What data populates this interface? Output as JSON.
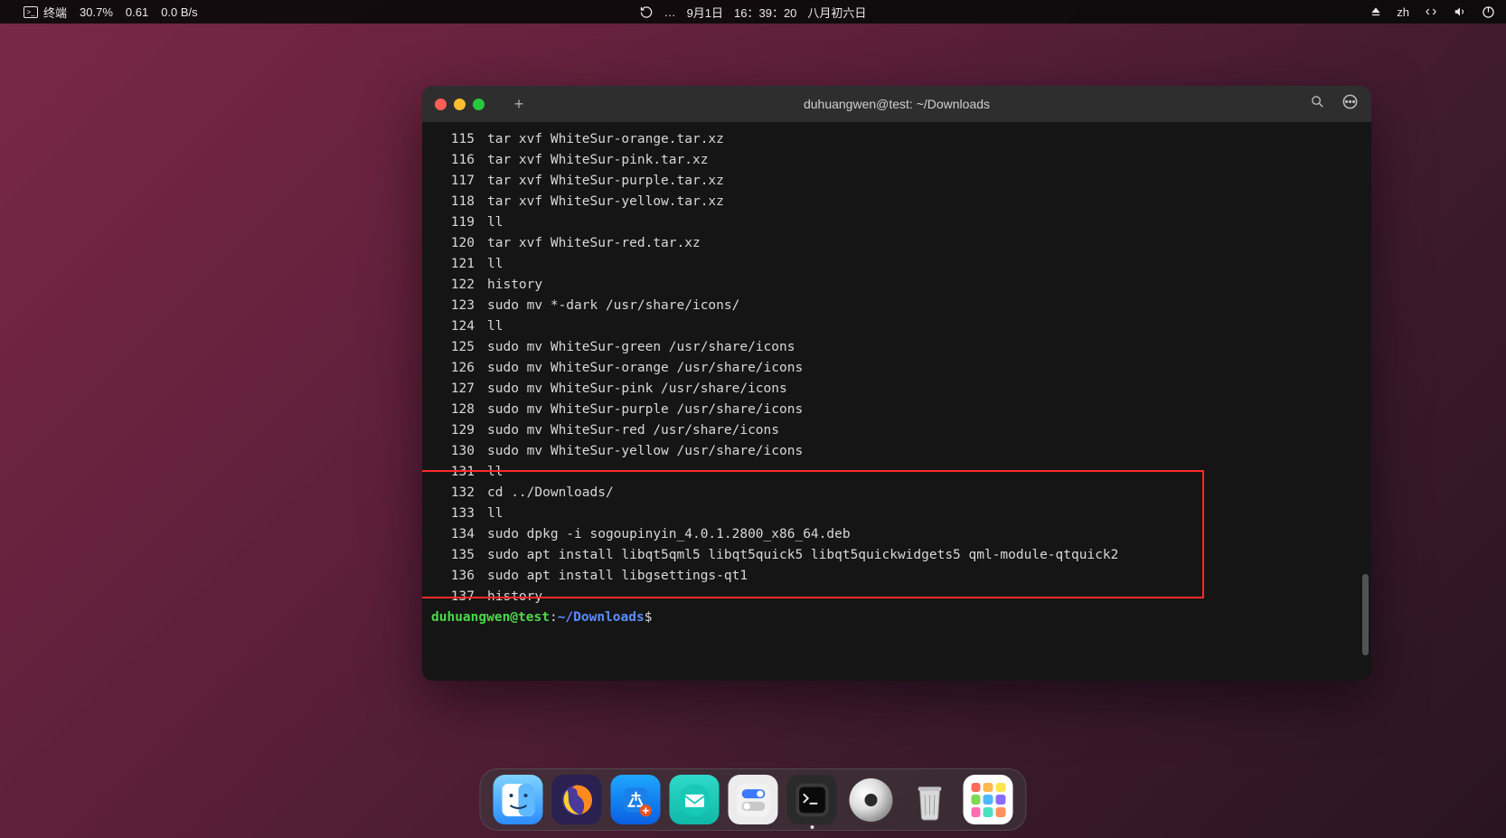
{
  "menubar": {
    "app_name": "终端",
    "stat1": "30.7%",
    "stat2": "0.61",
    "stat3": "0.0 B/s",
    "center_date": "9月1日",
    "center_time": "16：39：20",
    "center_lunar": "八月初六日",
    "center_ellipsis": "…",
    "input_lang": "zh"
  },
  "terminal": {
    "title": "duhuangwen@test: ~/Downloads",
    "prompt_user": "duhuangwen@test",
    "prompt_colon": ":",
    "prompt_path": "~/Downloads",
    "prompt_dollar": "$",
    "history": [
      {
        "n": "115",
        "cmd": "tar xvf WhiteSur-orange.tar.xz"
      },
      {
        "n": "116",
        "cmd": "tar xvf WhiteSur-pink.tar.xz"
      },
      {
        "n": "117",
        "cmd": "tar xvf WhiteSur-purple.tar.xz"
      },
      {
        "n": "118",
        "cmd": "tar xvf WhiteSur-yellow.tar.xz"
      },
      {
        "n": "119",
        "cmd": "ll"
      },
      {
        "n": "120",
        "cmd": "tar xvf WhiteSur-red.tar.xz"
      },
      {
        "n": "121",
        "cmd": "ll"
      },
      {
        "n": "122",
        "cmd": "history"
      },
      {
        "n": "123",
        "cmd": "sudo mv *-dark /usr/share/icons/"
      },
      {
        "n": "124",
        "cmd": "ll"
      },
      {
        "n": "125",
        "cmd": "sudo mv WhiteSur-green /usr/share/icons"
      },
      {
        "n": "126",
        "cmd": "sudo mv WhiteSur-orange /usr/share/icons"
      },
      {
        "n": "127",
        "cmd": "sudo mv WhiteSur-pink /usr/share/icons"
      },
      {
        "n": "128",
        "cmd": "sudo mv WhiteSur-purple /usr/share/icons"
      },
      {
        "n": "129",
        "cmd": "sudo mv WhiteSur-red /usr/share/icons"
      },
      {
        "n": "130",
        "cmd": "sudo mv WhiteSur-yellow /usr/share/icons"
      },
      {
        "n": "131",
        "cmd": "ll"
      },
      {
        "n": "132",
        "cmd": "cd ../Downloads/"
      },
      {
        "n": "133",
        "cmd": "ll"
      },
      {
        "n": "134",
        "cmd": "sudo dpkg -i sogoupinyin_4.0.1.2800_x86_64.deb"
      },
      {
        "n": "135",
        "cmd": "sudo apt install libqt5qml5 libqt5quick5 libqt5quickwidgets5 qml-module-qtquick2"
      },
      {
        "n": "136",
        "cmd": "sudo apt install libgsettings-qt1"
      },
      {
        "n": "137",
        "cmd": "history"
      }
    ]
  },
  "dock": {
    "items": [
      {
        "name": "files",
        "active": false
      },
      {
        "name": "firefox",
        "active": false
      },
      {
        "name": "software-store",
        "active": false
      },
      {
        "name": "mail",
        "active": false
      },
      {
        "name": "settings",
        "active": false
      },
      {
        "name": "terminal",
        "active": true
      },
      {
        "name": "disc",
        "active": false
      },
      {
        "name": "trash",
        "active": false
      },
      {
        "name": "app-grid",
        "active": false
      }
    ]
  }
}
